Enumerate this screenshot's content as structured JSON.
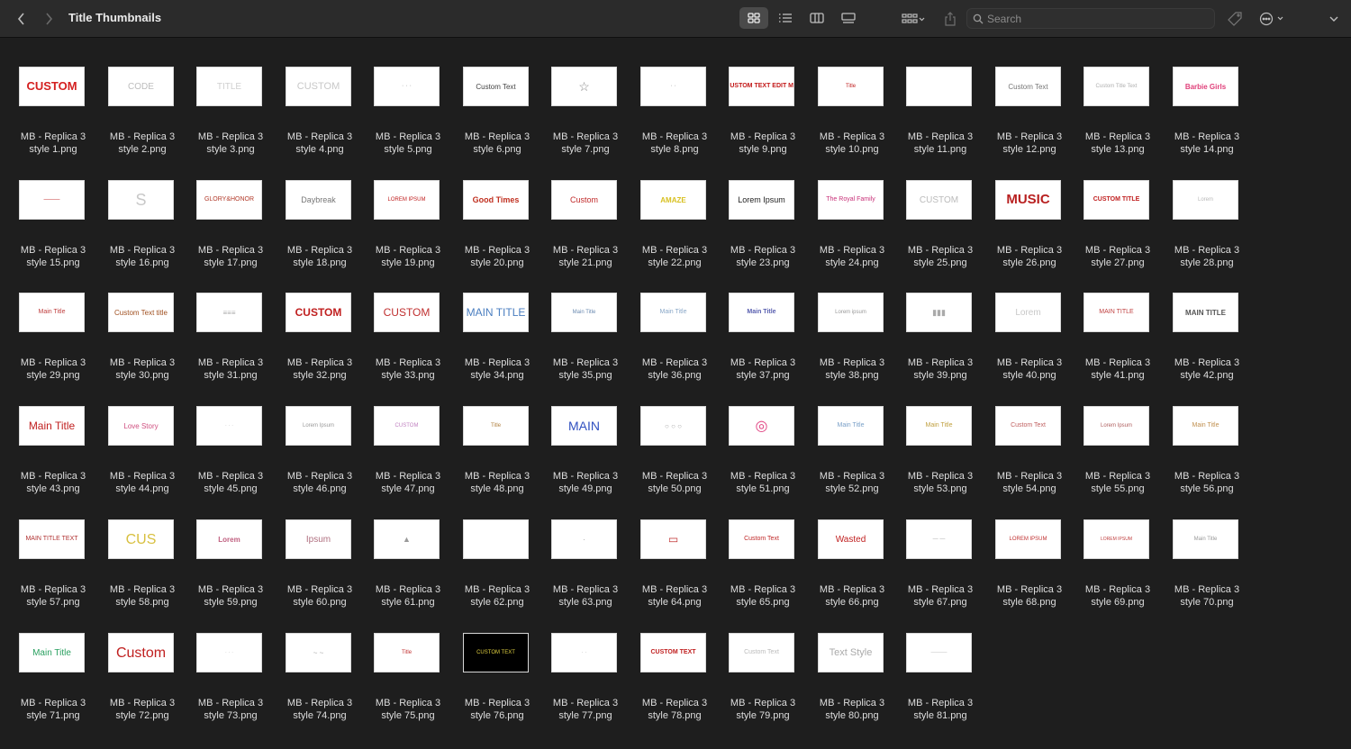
{
  "window": {
    "title": "Title Thumbnails"
  },
  "toolbar": {
    "search_placeholder": "Search"
  },
  "files": [
    {
      "line1": "MB - Replica 3",
      "line2": "style 1.png",
      "art": "CUSTOM",
      "color": "#d42020",
      "size": 13,
      "weight": "bold"
    },
    {
      "line1": "MB - Replica 3",
      "line2": "style 2.png",
      "art": "CODE",
      "color": "#bdbdbd",
      "size": 10
    },
    {
      "line1": "MB - Replica 3",
      "line2": "style 3.png",
      "art": "TITLE",
      "color": "#cfcfcf",
      "size": 10
    },
    {
      "line1": "MB - Replica 3",
      "line2": "style 4.png",
      "art": "CUSTOM",
      "color": "#c8c8c8",
      "size": 11
    },
    {
      "line1": "MB - Replica 3",
      "line2": "style 5.png",
      "art": "· · ·",
      "color": "#999",
      "size": 7
    },
    {
      "line1": "MB - Replica 3",
      "line2": "style 6.png",
      "art": "Custom Text",
      "color": "#444",
      "size": 8
    },
    {
      "line1": "MB - Replica 3",
      "line2": "style 7.png",
      "art": "☆",
      "color": "#888",
      "size": 14
    },
    {
      "line1": "MB - Replica 3",
      "line2": "style 8.png",
      "art": "· ·",
      "color": "#999",
      "size": 7
    },
    {
      "line1": "MB - Replica 3",
      "line2": "style 9.png",
      "art": "CUSTOM TEXT EDIT ME",
      "color": "#c21818",
      "size": 7,
      "weight": "bold"
    },
    {
      "line1": "MB - Replica 3",
      "line2": "style 10.png",
      "art": "Title",
      "color": "#c02020",
      "size": 6
    },
    {
      "line1": "MB - Replica 3",
      "line2": "style 11.png",
      "art": "",
      "color": "#999",
      "size": 6
    },
    {
      "line1": "MB - Replica 3",
      "line2": "style 12.png",
      "art": "Custom Text",
      "color": "#777",
      "size": 8
    },
    {
      "line1": "MB - Replica 3",
      "line2": "style 13.png",
      "art": "Custom Title Text",
      "color": "#b0b0b0",
      "size": 6
    },
    {
      "line1": "MB - Replica 3",
      "line2": "style 14.png",
      "art": "Barbie Girls",
      "color": "#e0407a",
      "size": 8,
      "weight": "bold"
    },
    {
      "line1": "MB - Replica 3",
      "line2": "style 15.png",
      "art": "———",
      "color": "#c02020",
      "size": 6
    },
    {
      "line1": "MB - Replica 3",
      "line2": "style 16.png",
      "art": "S",
      "color": "#c8c8c8",
      "size": 18
    },
    {
      "line1": "MB - Replica 3",
      "line2": "style 17.png",
      "art": "GLORY&HONOR",
      "color": "#b23a2a",
      "size": 7
    },
    {
      "line1": "MB - Replica 3",
      "line2": "style 18.png",
      "art": "Daybreak",
      "color": "#777",
      "size": 9
    },
    {
      "line1": "MB - Replica 3",
      "line2": "style 19.png",
      "art": "LOREM IPSUM",
      "color": "#c02020",
      "size": 6
    },
    {
      "line1": "MB - Replica 3",
      "line2": "style 20.png",
      "art": "Good Times",
      "color": "#c03020",
      "size": 9,
      "weight": "bold"
    },
    {
      "line1": "MB - Replica 3",
      "line2": "style 21.png",
      "art": "Custom",
      "color": "#c02828",
      "size": 9
    },
    {
      "line1": "MB - Replica 3",
      "line2": "style 22.png",
      "art": "AMAZE",
      "color": "#d8c020",
      "size": 8,
      "weight": "bold"
    },
    {
      "line1": "MB - Replica 3",
      "line2": "style 23.png",
      "art": "Lorem Ipsum",
      "color": "#222",
      "size": 9
    },
    {
      "line1": "MB - Replica 3",
      "line2": "style 24.png",
      "art": "The Royal Family",
      "color": "#c83078",
      "size": 7
    },
    {
      "line1": "MB - Replica 3",
      "line2": "style 25.png",
      "art": "CUSTOM",
      "color": "#bbbbbb",
      "size": 10
    },
    {
      "line1": "MB - Replica 3",
      "line2": "style 26.png",
      "art": "MUSIC",
      "color": "#b82020",
      "size": 15,
      "weight": "bold"
    },
    {
      "line1": "MB - Replica 3",
      "line2": "style 27.png",
      "art": "CUSTOM TITLE",
      "color": "#c02020",
      "size": 7,
      "weight": "bold"
    },
    {
      "line1": "MB - Replica 3",
      "line2": "style 28.png",
      "art": "Lorem",
      "color": "#b8b8b8",
      "size": 6
    },
    {
      "line1": "MB - Replica 3",
      "line2": "style 29.png",
      "art": "Main Title",
      "color": "#c04040",
      "size": 7
    },
    {
      "line1": "MB - Replica 3",
      "line2": "style 30.png",
      "art": "Custom Text title",
      "color": "#a05020",
      "size": 8
    },
    {
      "line1": "MB - Replica 3",
      "line2": "style 31.png",
      "art": "≡≡≡",
      "color": "#aaa",
      "size": 8
    },
    {
      "line1": "MB - Replica 3",
      "line2": "style 32.png",
      "art": "CUSTOM",
      "color": "#c02020",
      "size": 12,
      "weight": "bold"
    },
    {
      "line1": "MB - Replica 3",
      "line2": "style 33.png",
      "art": "CUSTOM",
      "color": "#c03030",
      "size": 12
    },
    {
      "line1": "MB - Replica 3",
      "line2": "style 34.png",
      "art": "MAIN TITLE",
      "color": "#4a7ec0",
      "size": 12
    },
    {
      "line1": "MB - Replica 3",
      "line2": "style 35.png",
      "art": "Main Title",
      "color": "#6a8ab0",
      "size": 6
    },
    {
      "line1": "MB - Replica 3",
      "line2": "style 36.png",
      "art": "Main Title",
      "color": "#8aa8c8",
      "size": 7
    },
    {
      "line1": "MB - Replica 3",
      "line2": "style 37.png",
      "art": "Main Title",
      "color": "#5a60b0",
      "size": 7,
      "weight": "bold"
    },
    {
      "line1": "MB - Replica 3",
      "line2": "style 38.png",
      "art": "Lorem ipsum",
      "color": "#999",
      "size": 6
    },
    {
      "line1": "MB - Replica 3",
      "line2": "style 39.png",
      "art": "▮▮▮",
      "color": "#aaa",
      "size": 9
    },
    {
      "line1": "MB - Replica 3",
      "line2": "style 40.png",
      "art": "Lorem",
      "color": "#c8c8c8",
      "size": 10
    },
    {
      "line1": "MB - Replica 3",
      "line2": "style 41.png",
      "art": "MAIN TITLE",
      "color": "#c04040",
      "size": 7
    },
    {
      "line1": "MB - Replica 3",
      "line2": "style 42.png",
      "art": "MAIN TITLE",
      "color": "#555",
      "size": 8,
      "weight": "bold"
    },
    {
      "line1": "MB - Replica 3",
      "line2": "style 43.png",
      "art": "Main Title",
      "color": "#c02020",
      "size": 12
    },
    {
      "line1": "MB - Replica 3",
      "line2": "style 44.png",
      "art": "Love Story",
      "color": "#d05080",
      "size": 8
    },
    {
      "line1": "MB - Replica 3",
      "line2": "style 45.png",
      "art": "· · ·",
      "color": "#bbb",
      "size": 6
    },
    {
      "line1": "MB - Replica 3",
      "line2": "style 46.png",
      "art": "Lorem Ipsum",
      "color": "#999",
      "size": 6
    },
    {
      "line1": "MB - Replica 3",
      "line2": "style 47.png",
      "art": "CUSTOM",
      "color": "#c080c0",
      "size": 6
    },
    {
      "line1": "MB - Replica 3",
      "line2": "style 48.png",
      "art": "Title",
      "color": "#b08040",
      "size": 6
    },
    {
      "line1": "MB - Replica 3",
      "line2": "style 49.png",
      "art": "MAIN",
      "color": "#3050c0",
      "size": 14
    },
    {
      "line1": "MB - Replica 3",
      "line2": "style 50.png",
      "art": "○ ○ ○",
      "color": "#aaa",
      "size": 8
    },
    {
      "line1": "MB - Replica 3",
      "line2": "style 51.png",
      "art": "◎",
      "color": "#e04080",
      "size": 16
    },
    {
      "line1": "MB - Replica 3",
      "line2": "style 52.png",
      "art": "Main Title",
      "color": "#7aa0c8",
      "size": 7
    },
    {
      "line1": "MB - Replica 3",
      "line2": "style 53.png",
      "art": "Main Title",
      "color": "#c0a040",
      "size": 7
    },
    {
      "line1": "MB - Replica 3",
      "line2": "style 54.png",
      "art": "Custom Text",
      "color": "#c06060",
      "size": 7
    },
    {
      "line1": "MB - Replica 3",
      "line2": "style 55.png",
      "art": "Lorem Ipsum",
      "color": "#b06060",
      "size": 6
    },
    {
      "line1": "MB - Replica 3",
      "line2": "style 56.png",
      "art": "Main Title",
      "color": "#c09050",
      "size": 7
    },
    {
      "line1": "MB - Replica 3",
      "line2": "style 57.png",
      "art": "MAIN TITLE TEXT",
      "color": "#b03030",
      "size": 7
    },
    {
      "line1": "MB - Replica 3",
      "line2": "style 58.png",
      "art": "CUS",
      "color": "#d8c040",
      "size": 16
    },
    {
      "line1": "MB - Replica 3",
      "line2": "style 59.png",
      "art": "Lorem",
      "color": "#c06080",
      "size": 8,
      "weight": "bold"
    },
    {
      "line1": "MB - Replica 3",
      "line2": "style 60.png",
      "art": "Ipsum",
      "color": "#b07080",
      "size": 10
    },
    {
      "line1": "MB - Replica 3",
      "line2": "style 61.png",
      "art": "▲",
      "color": "#999",
      "size": 9
    },
    {
      "line1": "MB - Replica 3",
      "line2": "style 62.png",
      "art": "",
      "color": "#999",
      "size": 6
    },
    {
      "line1": "MB - Replica 3",
      "line2": "style 63.png",
      "art": "·",
      "color": "#999",
      "size": 8
    },
    {
      "line1": "MB - Replica 3",
      "line2": "style 64.png",
      "art": "▭",
      "color": "#c03030",
      "size": 12
    },
    {
      "line1": "MB - Replica 3",
      "line2": "style 65.png",
      "art": "Custom Text",
      "color": "#c02828",
      "size": 7
    },
    {
      "line1": "MB - Replica 3",
      "line2": "style 66.png",
      "art": "Wasted",
      "color": "#c02020",
      "size": 10
    },
    {
      "line1": "MB - Replica 3",
      "line2": "style 67.png",
      "art": "— —",
      "color": "#aaa",
      "size": 6
    },
    {
      "line1": "MB - Replica 3",
      "line2": "style 68.png",
      "art": "LOREM IPSUM",
      "color": "#c03030",
      "size": 6
    },
    {
      "line1": "MB - Replica 3",
      "line2": "style 69.png",
      "art": "LOREM IPSUM",
      "color": "#c04040",
      "size": 5
    },
    {
      "line1": "MB - Replica 3",
      "line2": "style 70.png",
      "art": "Main Title",
      "color": "#999",
      "size": 6
    },
    {
      "line1": "MB - Replica 3",
      "line2": "style 71.png",
      "art": "Main Title",
      "color": "#2aa060",
      "size": 10
    },
    {
      "line1": "MB - Replica 3",
      "line2": "style 72.png",
      "art": "Custom",
      "color": "#c02020",
      "size": 16
    },
    {
      "line1": "MB - Replica 3",
      "line2": "style 73.png",
      "art": "· · ·",
      "color": "#bbb",
      "size": 6
    },
    {
      "line1": "MB - Replica 3",
      "line2": "style 74.png",
      "art": "~ ~",
      "color": "#aaa",
      "size": 8
    },
    {
      "line1": "MB - Replica 3",
      "line2": "style 75.png",
      "art": "Title",
      "color": "#c03030",
      "size": 6
    },
    {
      "line1": "MB - Replica 3",
      "line2": "style 76.png",
      "art": "CUSTOM TEXT",
      "color": "#e0d040",
      "size": 6,
      "dark": true
    },
    {
      "line1": "MB - Replica 3",
      "line2": "style 77.png",
      "art": "· ·",
      "color": "#aaa",
      "size": 6
    },
    {
      "line1": "MB - Replica 3",
      "line2": "style 78.png",
      "art": "CUSTOM TEXT",
      "color": "#c02020",
      "size": 7,
      "weight": "bold"
    },
    {
      "line1": "MB - Replica 3",
      "line2": "style 79.png",
      "art": "Custom Text",
      "color": "#bbb",
      "size": 7
    },
    {
      "line1": "MB - Replica 3",
      "line2": "style 80.png",
      "art": "Text Style",
      "color": "#aaa",
      "size": 11
    },
    {
      "line1": "MB - Replica 3",
      "line2": "style 81.png",
      "art": "———",
      "color": "#bbb",
      "size": 6
    }
  ],
  "colors": {
    "toolbar_bg": "#2b2b2b",
    "window_bg": "#1e1e1e",
    "label_text": "#dedede",
    "active_view": "#4a4a4a"
  },
  "icons": [
    "chevron-left-icon",
    "chevron-right-icon",
    "icon-view-icon",
    "list-view-icon",
    "column-view-icon",
    "gallery-view-icon",
    "group-by-icon",
    "share-icon",
    "search-icon",
    "tag-icon",
    "more-icon",
    "chevron-down-icon"
  ]
}
